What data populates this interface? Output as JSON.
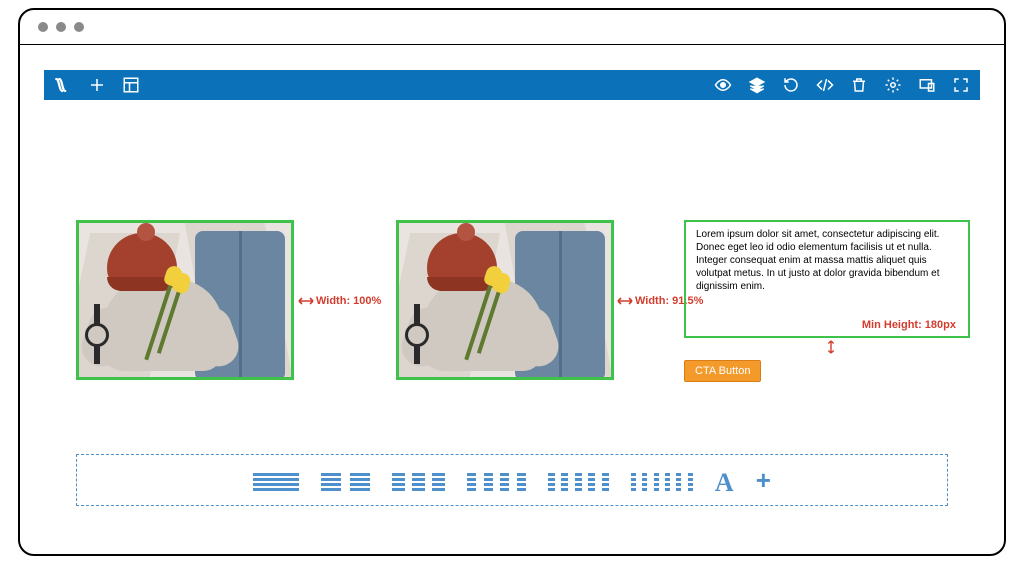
{
  "annotations": {
    "width1": "Width: 100%",
    "width2": "Width: 91.5%",
    "minHeight": "Min Height: 180px"
  },
  "textcard": {
    "body": "Lorem ipsum dolor sit amet, consectetur adipiscing elit. Donec eget leo id odio elementum facilisis ut et nulla. Integer consequat enim at massa mattis aliquet quis volutpat metus. In ut justo at dolor gravida bibendum et dignissim enim."
  },
  "cta": {
    "label": "CTA Button"
  },
  "toolbar": {
    "left": [
      "logo",
      "add",
      "layout"
    ],
    "right": [
      "preview",
      "layers",
      "history",
      "code",
      "delete",
      "settings",
      "responsive",
      "fullscreen"
    ]
  },
  "palette": {
    "items": [
      "list-1col",
      "list-2col",
      "list-3col",
      "list-4col",
      "list-5col",
      "list-6col",
      "text",
      "add"
    ]
  }
}
